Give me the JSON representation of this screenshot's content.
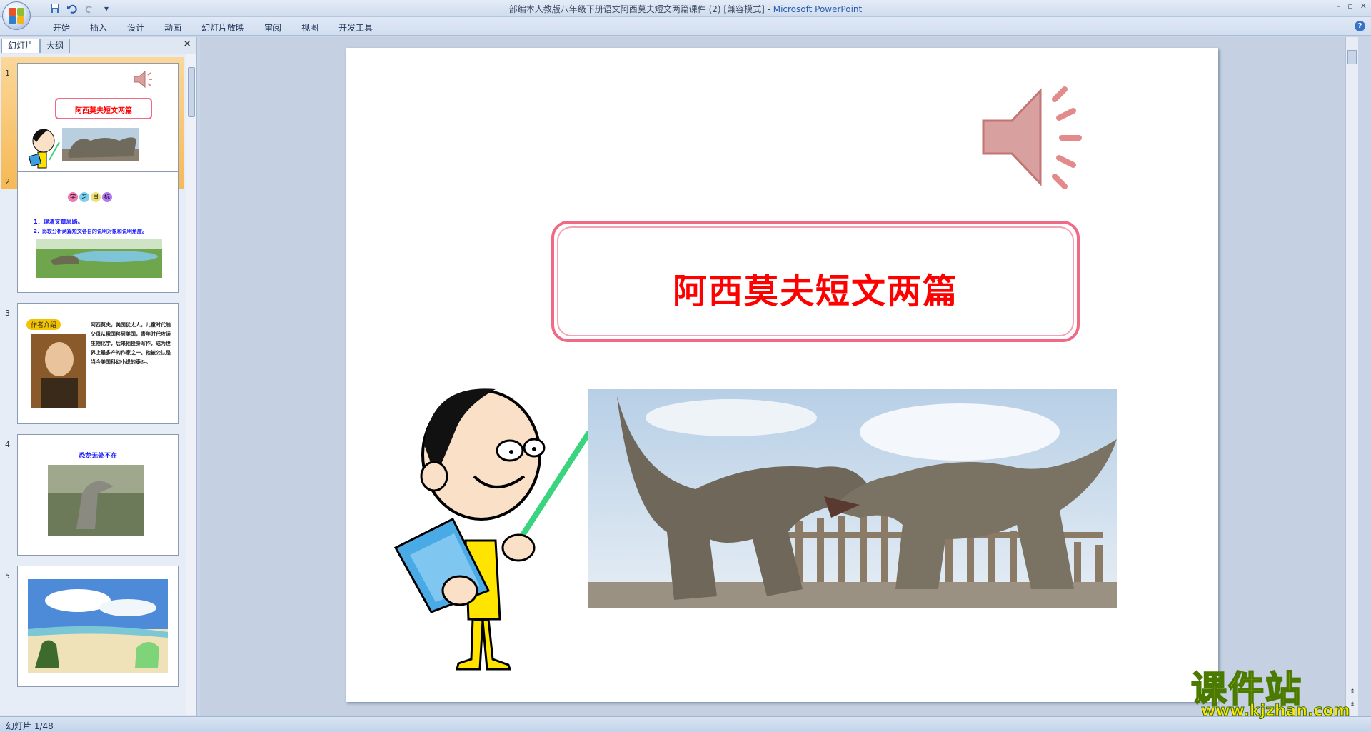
{
  "window": {
    "title": "部编本人教版八年级下册语文阿西莫夫短文两篇课件 (2) [兼容模式] - ",
    "app_name": "Microsoft PowerPoint",
    "controls": [
      "–",
      "▫",
      "✕"
    ]
  },
  "quick_access": [
    "save-icon",
    "undo-icon",
    "redo-icon"
  ],
  "ribbon": {
    "tabs": [
      "开始",
      "插入",
      "设计",
      "动画",
      "幻灯片放映",
      "审阅",
      "视图",
      "开发工具"
    ],
    "help": "?"
  },
  "pane": {
    "tabs": [
      "幻灯片",
      "大纲"
    ],
    "close": "✕"
  },
  "thumbnails": [
    {
      "num": "1",
      "title": "阿西莫夫短文两篇"
    },
    {
      "num": "2",
      "badge": [
        "学",
        "习",
        "目",
        "标"
      ],
      "lines": [
        "1．理清文章思路。",
        "2．比较分析两篇短文各自的说明对象和说明角度。"
      ]
    },
    {
      "num": "3",
      "badge": "作者介绍",
      "text": "阿西莫夫，美国犹太人，儿童时代随父母从俄国移居美国，青年时代攻读生物化学，后来他投身写作，成为世界上最多产的作家之一。他被公认是当今美国科幻小说的泰斗。"
    },
    {
      "num": "4",
      "title": "恐龙无处不在"
    },
    {
      "num": "5"
    }
  ],
  "slide": {
    "title": "阿西莫夫短文两篇"
  },
  "status": {
    "slide_counter": "幻灯片 1/48"
  },
  "watermark": {
    "main": "课件站",
    "url": "www.kjzhan.com"
  }
}
